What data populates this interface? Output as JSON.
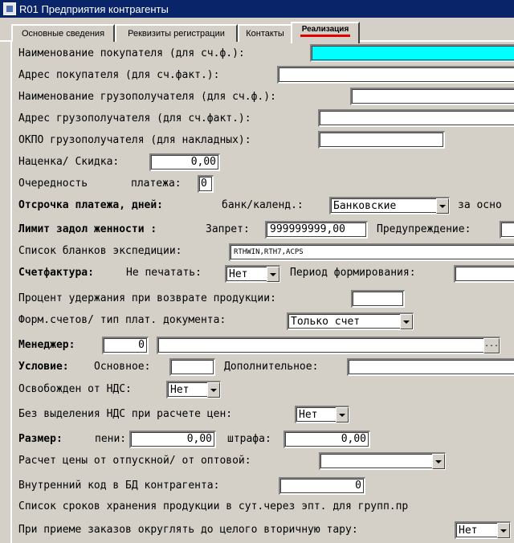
{
  "window": {
    "title": "R01 Предприятия контрагенты"
  },
  "tabs": [
    {
      "label": "Основные сведения"
    },
    {
      "label": "Реквизиты регистрации"
    },
    {
      "label": "Контакты"
    },
    {
      "label": "Реализация"
    }
  ],
  "form": {
    "buyer_name": {
      "label": "Наименование покупателя (для сч.ф.):",
      "value": ""
    },
    "buyer_address": {
      "label": "Адрес покупателя (для сч.факт.):",
      "value": ""
    },
    "consignee_name": {
      "label": "Наименование грузополучателя (для сч.ф.):",
      "value": ""
    },
    "consignee_address": {
      "label": "Адрес грузополучателя (для сч.факт.):",
      "value": ""
    },
    "consignee_okpo": {
      "label": "ОКПО грузополучателя (для накладных):",
      "value": ""
    },
    "markup": {
      "label": "Наценка/ Скидка:",
      "value": "0,00"
    },
    "payment_order": {
      "label1": "Очередность",
      "label2": "платежа:",
      "value": "0"
    },
    "deferral": {
      "label": "Отсрочка платежа,  дней:",
      "label2": "банк/календ.:",
      "value": "Банковские",
      "label3": "за осно"
    },
    "debt_limit": {
      "label": "Лимит задол женности :",
      "ban_label": "Запрет:",
      "ban_value": "999999999,00",
      "warn_label": "Предупреждение:",
      "warn_value": ""
    },
    "forms_list": {
      "label": "Список бланков экспедиции:",
      "value": "RTHWIN,RTH7,ACPS"
    },
    "invoice": {
      "label": "Счетфактура:",
      "noprint_label": "Не печатать:",
      "noprint_value": "Нет",
      "period_label": "Период формирования:",
      "period_value": ""
    },
    "retention": {
      "label": "Процент удержания при возврате продукции:",
      "value": ""
    },
    "doc_type": {
      "label": "Форм.счетов/ тип плат. документа:",
      "value": "Только счет"
    },
    "manager": {
      "label": "Менеджер:",
      "code": "0",
      "name": "",
      "button": "..."
    },
    "condition": {
      "label": "Условие:",
      "main_label": "Основное:",
      "main_value": "",
      "extra_label": "Дополнительное:",
      "extra_value": ""
    },
    "vat_exempt": {
      "label": "Освобожден от НДС:",
      "value": "Нет"
    },
    "no_vat_split": {
      "label": "Без выделения НДС при расчете цен:",
      "value": "Нет"
    },
    "size": {
      "label": "Размер:",
      "penalty_label": "пени:",
      "penalty_value": "0,00",
      "fine_label": "штрафа:",
      "fine_value": "0,00"
    },
    "price_calc": {
      "label": "Расчет цены от отпускной/ от оптовой:",
      "value": ""
    },
    "internal_code": {
      "label": "Внутренний код в БД контрагента:",
      "value": "0"
    },
    "storage_terms": {
      "label": "Список сроков хранения продукции в сут.через эпт. для групп.пр"
    },
    "rounding": {
      "label": "При приеме заказов округлять до целого вторичную тару:",
      "value": "Нет"
    }
  },
  "colors": {
    "titlebar": "#0a246a",
    "highlight_field": "#00ffff",
    "active_tab_underline": "#e00000"
  }
}
